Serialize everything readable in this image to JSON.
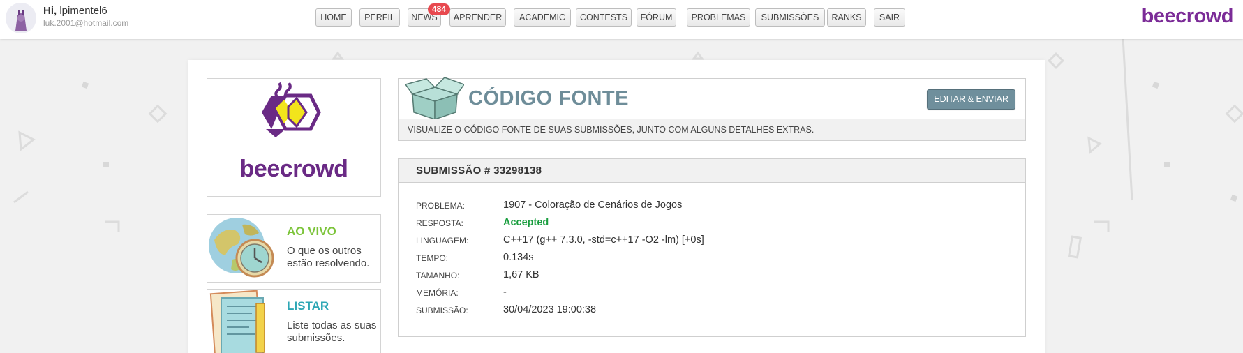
{
  "header": {
    "greeting": "Hi,",
    "username": "lpimentel6",
    "email": "luk.2001@hotmail.com",
    "brand": "beecrowd"
  },
  "nav": {
    "items": [
      "HOME",
      "PERFIL",
      "NEWS",
      "APRENDER",
      "ACADEMIC",
      "CONTESTS",
      "FÓRUM",
      "PROBLEMAS",
      "SUBMISSÕES",
      "RANKS",
      "SAIR"
    ],
    "news_badge": "484"
  },
  "sidebar": {
    "logo_text": "beecrowd",
    "live": {
      "title": "AO VIVO",
      "desc": "O que os outros estão resolvendo."
    },
    "list": {
      "title": "LISTAR",
      "desc": "Liste todas as suas submissões."
    }
  },
  "source": {
    "title": "CÓDIGO FONTE",
    "edit_button": "EDITAR & ENVIAR",
    "description": "VISUALIZE O CÓDIGO FONTE DE SUAS SUBMISSÕES, JUNTO COM ALGUNS DETALHES EXTRAS."
  },
  "submission": {
    "heading": "SUBMISSÃO # 33298138",
    "rows": [
      {
        "label": "PROBLEMA:",
        "value": "1907 - Coloração de Cenários de Jogos"
      },
      {
        "label": "RESPOSTA:",
        "value": "Accepted"
      },
      {
        "label": "LINGUAGEM:",
        "value": "C++17 (g++ 7.3.0, -std=c++17 -O2 -lm) [+0s]"
      },
      {
        "label": "TEMPO:",
        "value": "0.134s"
      },
      {
        "label": "TAMANHO:",
        "value": "1,67 KB"
      },
      {
        "label": "MEMÓRIA:",
        "value": "-"
      },
      {
        "label": "SUBMISSÃO:",
        "value": "30/04/2023 19:00:38"
      }
    ]
  },
  "colors": {
    "brand_purple": "#7b2b97",
    "accepted_green": "#1a9e3f",
    "live_green": "#7cc43a",
    "list_teal": "#2ea7b5",
    "title_gray_blue": "#6e8d99",
    "badge_red": "#e8494f"
  }
}
